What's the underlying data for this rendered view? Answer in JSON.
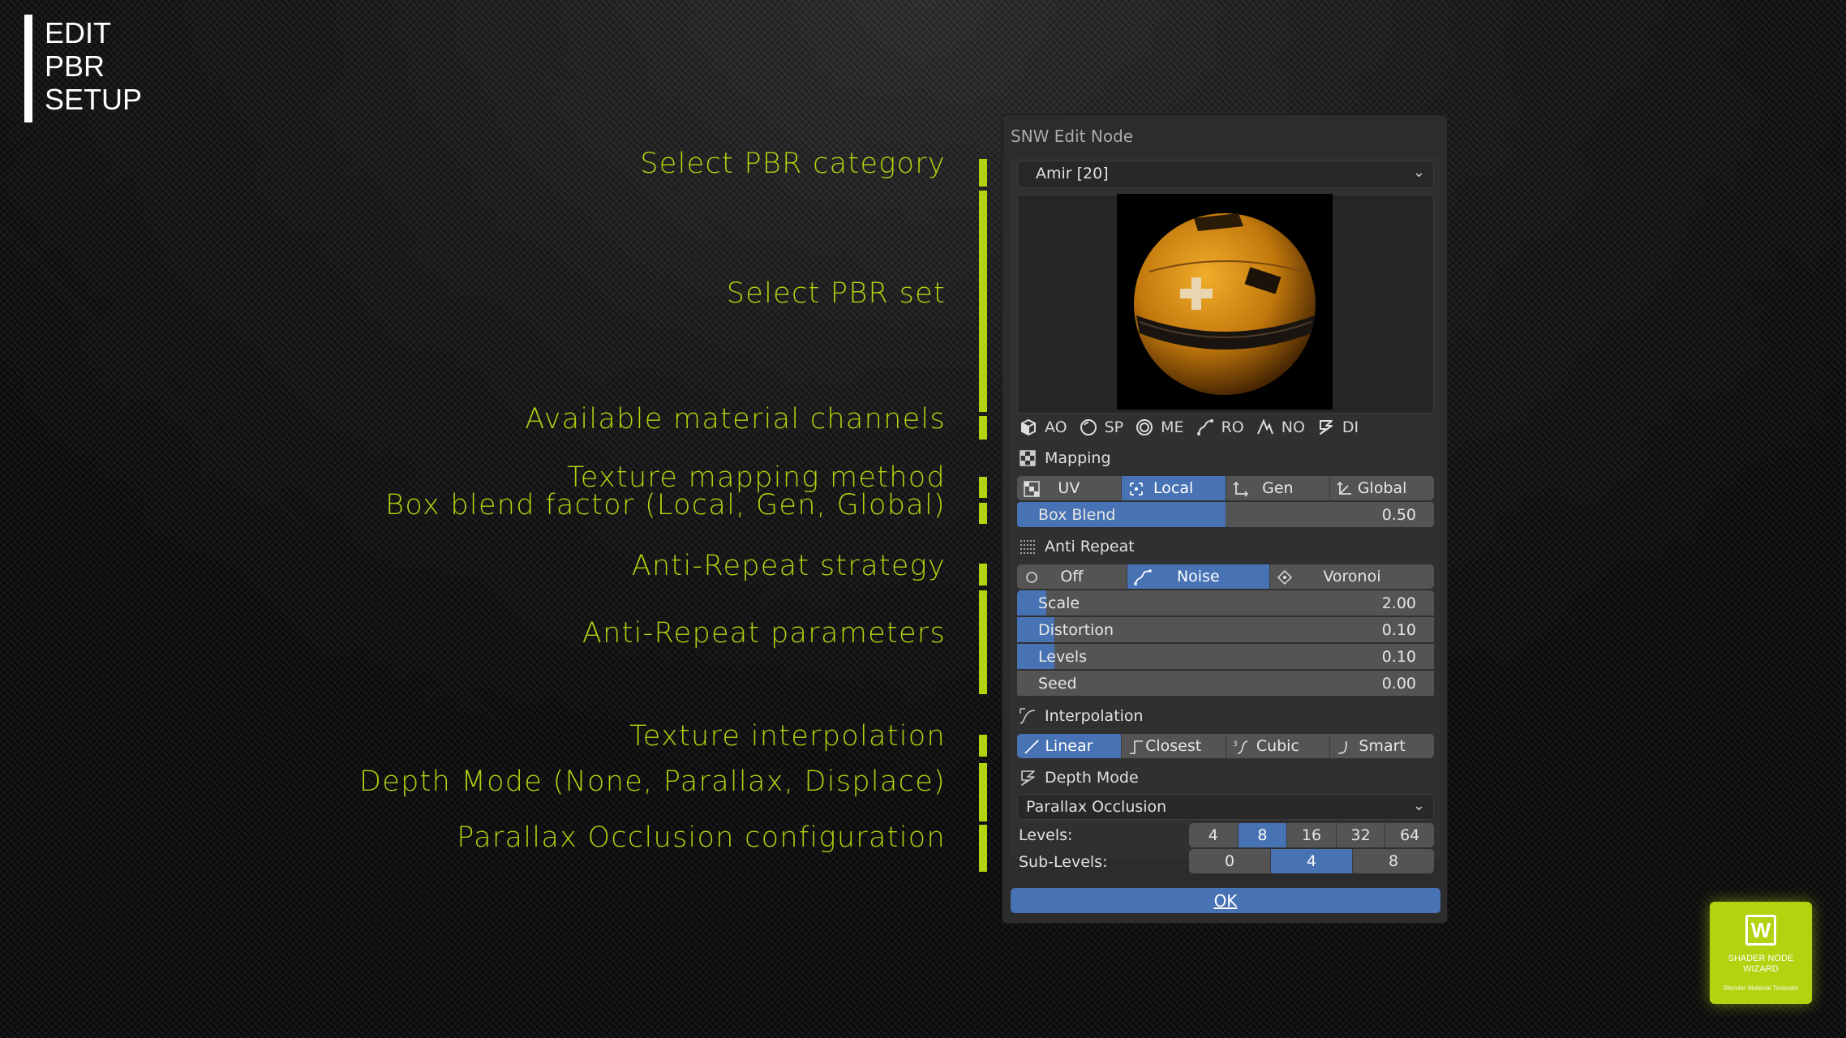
{
  "title_lines": [
    "EDIT",
    "PBR",
    "SETUP"
  ],
  "annotations": {
    "pbr_category": "Select PBR category",
    "pbr_set": "Select PBR set",
    "channels": "Available material channels",
    "mapping_method": "Texture mapping method",
    "box_blend": "Box blend factor (Local, Gen, Global)",
    "anti_repeat_strategy": "Anti-Repeat strategy",
    "anti_repeat_params": "Anti-Repeat parameters",
    "interpolation": "Texture interpolation",
    "depth_mode": "Depth Mode (None, Parallax, Displace)",
    "parallax_config": "Parallax Occlusion configuration"
  },
  "panel": {
    "title": "SNW Edit Node",
    "category_value": "Amir [20]",
    "channels": [
      "AO",
      "SP",
      "ME",
      "RO",
      "NO",
      "DI"
    ],
    "mapping": {
      "label": "Mapping",
      "options": [
        "UV",
        "Local",
        "Gen",
        "Global"
      ],
      "selected": "Local",
      "box_blend": {
        "label": "Box Blend",
        "value": "0.50",
        "fraction": 0.5
      }
    },
    "anti_repeat": {
      "label": "Anti Repeat",
      "options": [
        "Off",
        "Noise",
        "Voronoi"
      ],
      "selected": "Noise",
      "params": [
        {
          "label": "Scale",
          "value": "2.00",
          "fraction": 0.07
        },
        {
          "label": "Distortion",
          "value": "0.10",
          "fraction": 0.09
        },
        {
          "label": "Levels",
          "value": "0.10",
          "fraction": 0.09
        },
        {
          "label": "Seed",
          "value": "0.00",
          "fraction": 0.0
        }
      ]
    },
    "interpolation": {
      "label": "Interpolation",
      "options": [
        "Linear",
        "Closest",
        "Cubic",
        "Smart"
      ],
      "selected": "Linear"
    },
    "depth_mode": {
      "label": "Depth Mode",
      "value": "Parallax Occlusion",
      "levels_label": "Levels:",
      "levels": [
        "4",
        "8",
        "16",
        "32",
        "64"
      ],
      "levels_selected": "8",
      "sublevels_label": "Sub-Levels:",
      "sublevels": [
        "0",
        "4",
        "8"
      ],
      "sublevels_selected": "4"
    },
    "ok_label": "OK"
  },
  "logo": {
    "line1": "SHADER NODE",
    "line2": "WIZARD",
    "line3": "Blender Material Toolsuite"
  },
  "colors": {
    "accent": "#b4d20f",
    "blender_blue": "#4772b3",
    "panel_bg": "#2c2c2c"
  }
}
